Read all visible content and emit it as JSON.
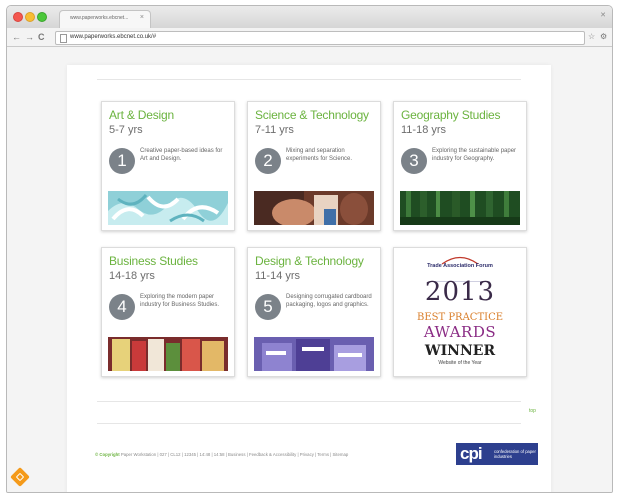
{
  "browser": {
    "tab_title": "www.paperworks.ebcnet...",
    "tab_close": "×",
    "url": "www.paperworks.ebcnet.co.uk/#",
    "back": "←",
    "forward": "→",
    "reload": "C",
    "star": "☆",
    "wrench": "⚙"
  },
  "cards": [
    {
      "title": "Art & Design",
      "age": "5-7 yrs",
      "number": "1",
      "description": "Creative paper-based ideas for Art and Design.",
      "image": "art-design-photo"
    },
    {
      "title": "Science & Technology",
      "age": "7-11 yrs",
      "number": "2",
      "description": "Mixing and separation experiments for Science.",
      "image": "science-photo"
    },
    {
      "title": "Geography Studies",
      "age": "11-18 yrs",
      "number": "3",
      "description": "Exploring the sustainable paper industry for Geography.",
      "image": "forest-photo"
    },
    {
      "title": "Business Studies",
      "age": "14-18 yrs",
      "number": "4",
      "description": "Exploring the modern paper industry for Business Studies.",
      "image": "business-photo"
    },
    {
      "title": "Design & Technology",
      "age": "11-14 yrs",
      "number": "5",
      "description": "Designing corrugated cardboard packaging, logos and graphics.",
      "image": "packaging-photo"
    }
  ],
  "award": {
    "forum": "Trade Association Forum",
    "year": "2013",
    "best": "BEST PRACTICE",
    "awards": "AWARDS",
    "winner": "WINNER",
    "sub": "Website of the Year"
  },
  "top_link": "top",
  "footer": {
    "copyright": "© Copyright",
    "text": "Paper Workstation | 027 | CL12 | 12345 | 14:48 | 14:58 | Business | Feedback & Accessibility | Privacy | Terms | Sitemap"
  },
  "cpi": {
    "mark": "cpi",
    "text": "confederation of paper industries"
  },
  "colors": {
    "accent_green": "#6bb33f",
    "number_circle": "#7b8289",
    "cpi_blue": "#2d3f8e",
    "badge_orange": "#f49a1a"
  }
}
